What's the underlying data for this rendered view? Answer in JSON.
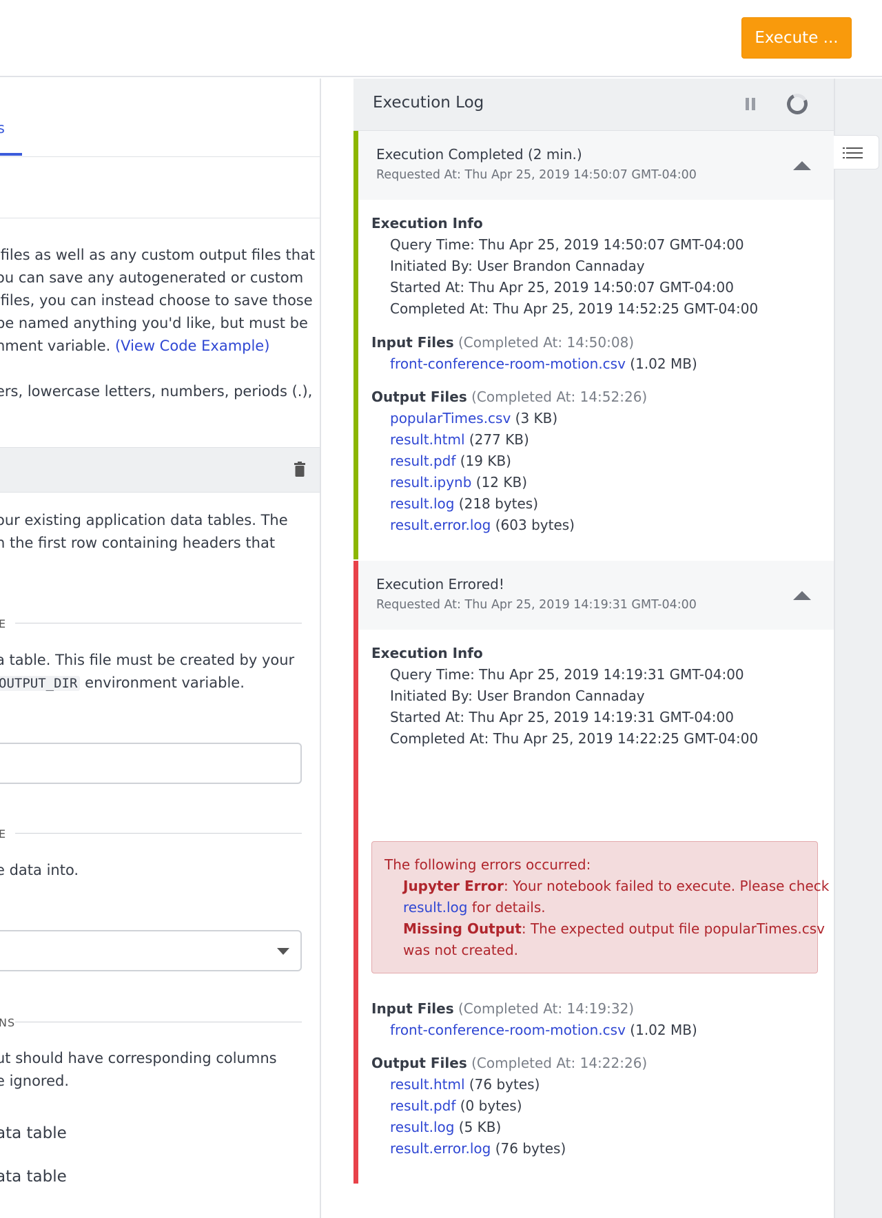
{
  "header": {
    "execute_button": "Execute ..."
  },
  "left": {
    "tab_fragment": "s",
    "intro_lines": [
      " files as well as any custom output files that",
      "ou can save any autogenerated or custom",
      " files, you can instead choose to save those",
      "be named anything you'd like, but must be",
      "nment variable. "
    ],
    "intro_link": "(View Code Example)",
    "naming_line": "ers, lowercase letters, numbers, periods (.),",
    "card_desc_lines": [
      "our existing application data tables. The",
      "h the first row containing headers that"
    ],
    "section1_label": "E",
    "section1_lines": [
      "a table. This file must be created by your",
      "environment variable."
    ],
    "section1_code": "OUTPUT_DIR",
    "section2_label": "E",
    "section2_line": "e data into.",
    "section3_label": "NS",
    "section3_lines": [
      "ut should have corresponding columns",
      "e ignored."
    ],
    "option1": "ata table",
    "option2": "ata table"
  },
  "log": {
    "title": "Execution Log",
    "entries": [
      {
        "status": "Execution Completed (2 min.)",
        "requested": "Requested At: Thu Apr 25, 2019 14:50:07 GMT-04:00",
        "info_title": "Execution Info",
        "info": [
          "Query Time: Thu Apr 25, 2019 14:50:07 GMT-04:00",
          "Initiated By: User Brandon Cannaday",
          "Started At: Thu Apr 25, 2019 14:50:07 GMT-04:00",
          "Completed At: Thu Apr 25, 2019 14:52:25 GMT-04:00"
        ],
        "input_title": "Input Files",
        "input_completed": "(Completed At: 14:50:08)",
        "inputs": [
          {
            "name": "front-conference-room-motion.csv",
            "size": "(1.02 MB)"
          }
        ],
        "output_title": "Output Files",
        "output_completed": "(Completed At: 14:52:26)",
        "outputs": [
          {
            "name": "popularTimes.csv",
            "size": "(3 KB)"
          },
          {
            "name": "result.html",
            "size": "(277 KB)"
          },
          {
            "name": "result.pdf",
            "size": "(19 KB)"
          },
          {
            "name": "result.ipynb",
            "size": "(12 KB)"
          },
          {
            "name": "result.log",
            "size": "(218 bytes)"
          },
          {
            "name": "result.error.log",
            "size": "(603 bytes)"
          }
        ]
      },
      {
        "status": "Execution Errored!",
        "requested": "Requested At: Thu Apr 25, 2019 14:19:31 GMT-04:00",
        "info_title": "Execution Info",
        "info": [
          "Query Time: Thu Apr 25, 2019 14:19:31 GMT-04:00",
          "Initiated By: User Brandon Cannaday",
          "Started At: Thu Apr 25, 2019 14:19:31 GMT-04:00",
          "Completed At: Thu Apr 25, 2019 14:22:25 GMT-04:00"
        ],
        "errors_title": "The following errors occurred:",
        "error1_label": "Jupyter Error",
        "error1_text": ": Your notebook failed to execute. Please check",
        "error1_link": "result.log",
        "error1_tail": " for details.",
        "error2_label": "Missing Output",
        "error2_text": ": The expected output file popularTimes.csv",
        "error2_tail": "was not created.",
        "input_title": "Input Files",
        "input_completed": "(Completed At: 14:19:32)",
        "inputs": [
          {
            "name": "front-conference-room-motion.csv",
            "size": "(1.02 MB)"
          }
        ],
        "output_title": "Output Files",
        "output_completed": "(Completed At: 14:22:26)",
        "outputs": [
          {
            "name": "result.html",
            "size": "(76 bytes)"
          },
          {
            "name": "result.pdf",
            "size": "(0 bytes)"
          },
          {
            "name": "result.log",
            "size": "(5 KB)"
          },
          {
            "name": "result.error.log",
            "size": "(76 bytes)"
          }
        ]
      }
    ]
  },
  "colors": {
    "accent": "#f99a0c",
    "success_bar": "#8cb600",
    "error_bar": "#e8424a",
    "link": "#2f47d3"
  }
}
